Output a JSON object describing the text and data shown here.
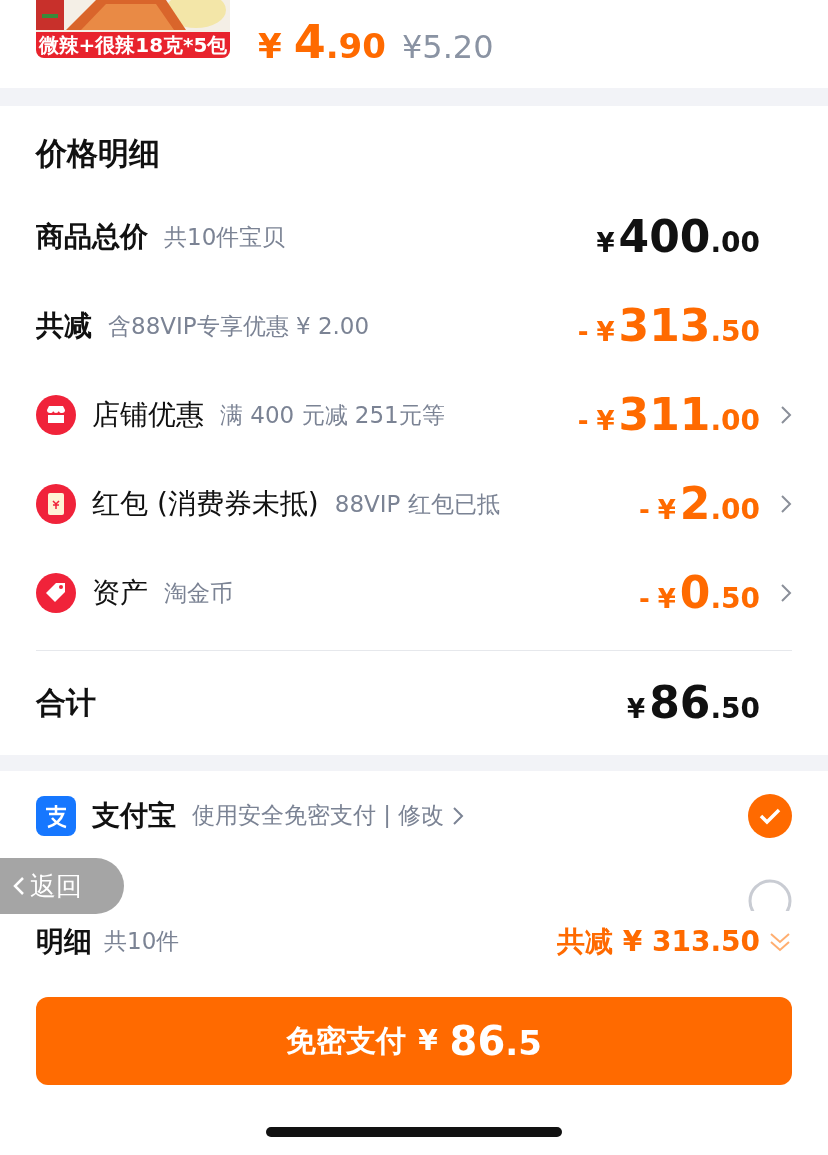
{
  "product": {
    "label": "微辣+很辣18克*5包",
    "price": {
      "currency": "¥",
      "integer": "4",
      "fraction": ".90"
    },
    "original_price": "¥5.20"
  },
  "price_detail": {
    "title": "价格明细",
    "rows": [
      {
        "kind": "main",
        "label": "商品总价",
        "note": "共10件宝贝",
        "amount": {
          "currency": "¥",
          "integer": "400",
          "fraction": ".00"
        },
        "highlight": false,
        "chevron": false
      },
      {
        "kind": "main",
        "label": "共减",
        "note": "含88VIP专享优惠 ¥ 2.00",
        "amount": {
          "prefix": "-",
          "currency": "¥",
          "integer": "313",
          "fraction": ".50"
        },
        "highlight": true,
        "chevron": false
      },
      {
        "kind": "shop",
        "label": "店铺优惠",
        "note": "满 400 元减 251元等",
        "amount": {
          "prefix": "-",
          "currency": "¥",
          "integer": "311",
          "fraction": ".00"
        },
        "highlight": true,
        "chevron": true
      },
      {
        "kind": "envelope",
        "label": "红包 (消费券未抵)",
        "note": "88VIP 红包已抵",
        "amount": {
          "prefix": "-",
          "currency": "¥",
          "integer": "2",
          "fraction": ".00"
        },
        "highlight": true,
        "chevron": true
      },
      {
        "kind": "tag",
        "label": "资产",
        "note": "淘金币",
        "amount": {
          "prefix": "-",
          "currency": "¥",
          "integer": "0",
          "fraction": ".50"
        },
        "highlight": true,
        "chevron": true
      }
    ],
    "total": {
      "label": "合计",
      "amount": {
        "currency": "¥",
        "integer": "86",
        "fraction": ".50"
      }
    }
  },
  "payment_methods": [
    {
      "name": "支付宝",
      "note": "使用安全免密支付 | 修改",
      "selected": true
    },
    {
      "selected": false
    }
  ],
  "back_button": "返回",
  "summary": {
    "label": "明细",
    "count": "共10件",
    "saving": "共减 ¥ 313.50"
  },
  "pay_button": {
    "label": "免密支付",
    "currency": "¥",
    "integer": "86",
    "fraction": ".5"
  }
}
